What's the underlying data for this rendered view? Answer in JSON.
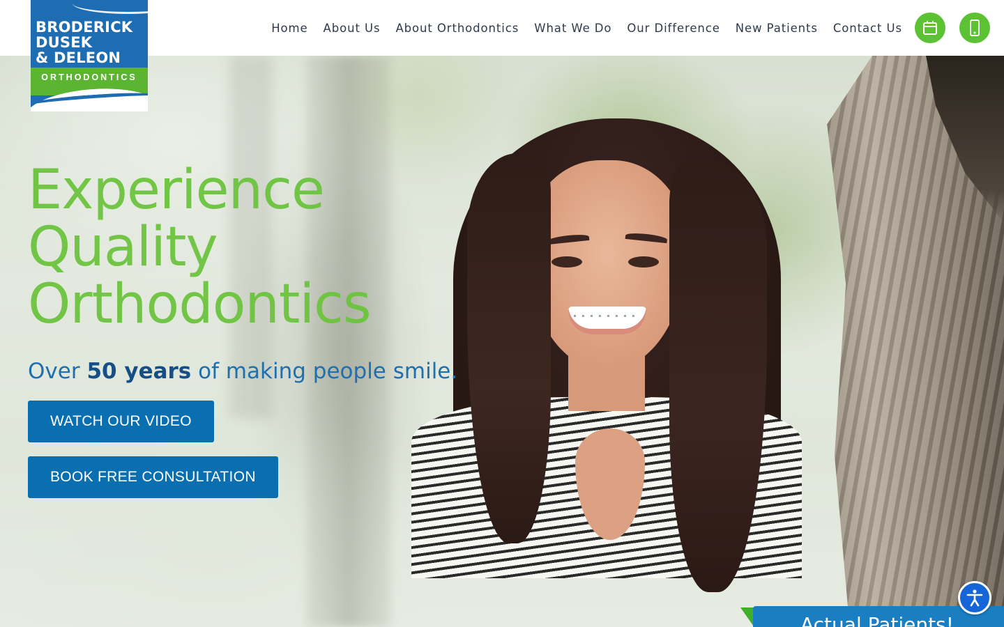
{
  "logo": {
    "line1": "BRODERICK",
    "line2": "DUSEK",
    "line3": "& DELEON",
    "subtitle": "ORTHODONTICS"
  },
  "nav": {
    "items": [
      {
        "label": "Home"
      },
      {
        "label": "About Us"
      },
      {
        "label": "About Orthodontics"
      },
      {
        "label": "What We Do"
      },
      {
        "label": "Our Difference"
      },
      {
        "label": "New Patients"
      },
      {
        "label": "Contact Us"
      }
    ],
    "calendar_icon": "calendar-icon",
    "phone_icon": "phone-icon"
  },
  "hero": {
    "headline": [
      "Experience",
      "Quality",
      "Orthodontics"
    ],
    "tagline_pre": "Over",
    "tagline_strong": "50 years",
    "tagline_post": "of making people smile.",
    "watch_video_label": "WATCH OUR VIDEO",
    "book_label": "BOOK FREE CONSULTATION"
  },
  "banner": {
    "text": "Actual Patients!"
  },
  "accessibility": {
    "icon": "accessibility-icon"
  },
  "colors": {
    "brand_blue": "#1e6db3",
    "brand_green": "#5cb531",
    "cta_blue": "#0a6fb0",
    "headline_green": "#6cc43e",
    "accessibility_blue": "#1565d8"
  }
}
